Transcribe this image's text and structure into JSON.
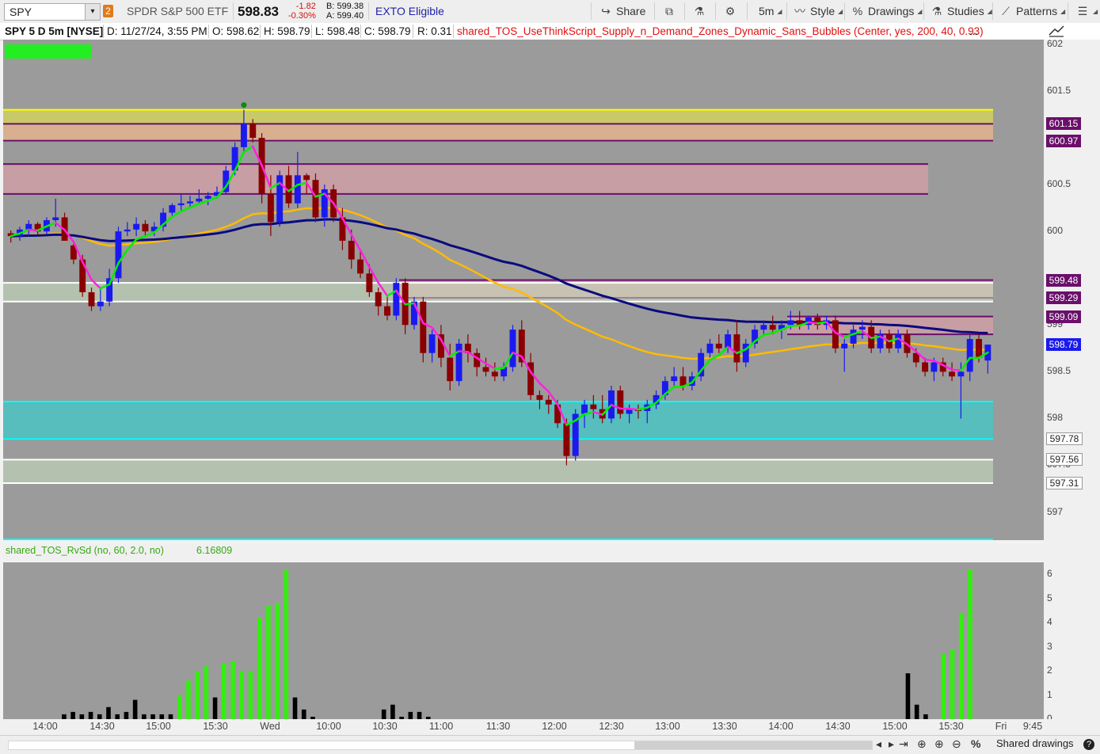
{
  "toolbar": {
    "symbol": "SPY",
    "link_number": "2",
    "description": "SPDR S&P 500 ETF",
    "last_price": "598.83",
    "net_change": "-1.82",
    "net_change_pct": "-0.30%",
    "bid": "B: 599.38",
    "ask": "A: 599.40",
    "exto": "EXTO Eligible",
    "share": "Share",
    "timeframe": "5m",
    "style": "Style",
    "drawings": "Drawings",
    "studies": "Studies",
    "patterns": "Patterns",
    "icons": {
      "share": "share-arrow-icon",
      "sync": "sync-icon",
      "flask": "flask-icon",
      "gear": "gear-icon",
      "style": "style-chart-icon",
      "drawings": "drawings-percent-icon",
      "studies": "studies-flask-icon",
      "patterns": "patterns-icon",
      "menu": "hamburger-menu-icon"
    }
  },
  "header": {
    "title": "SPY 5 D 5m [NYSE]",
    "date": "D: 11/27/24, 3:55 PM",
    "open": "O: 598.62",
    "high": "H: 598.79",
    "low": "L: 598.48",
    "close": "C: 598.79",
    "range": "R: 0.31",
    "study": "shared_TOS_UseThinkScript_Supply_n_Demand_Zones_Dynamic_Sans_Bubbles (Center, yes, 200, 40, 0.93)",
    "more": "..."
  },
  "lower_study": {
    "label": "shared_TOS_RvSd (no, 60, 2.0, no)",
    "value": "6.16809"
  },
  "price_axis": {
    "ticks": [
      "602",
      "601.5",
      "600.5",
      "600",
      "599",
      "598.5",
      "598",
      "597.5",
      "597"
    ],
    "tags": [
      {
        "label": "601.15",
        "color": "#6a0f6a"
      },
      {
        "label": "600.97",
        "color": "#6a0f6a"
      },
      {
        "label": "599.48",
        "color": "#6a0f6a"
      },
      {
        "label": "599.29",
        "color": "#6a0f6a"
      },
      {
        "label": "599.09",
        "color": "#6a0f6a"
      },
      {
        "label": "598.79",
        "color": "#1a1aee"
      },
      {
        "label": "597.78",
        "color": "#ffffff"
      },
      {
        "label": "597.56",
        "color": "#ffffff"
      },
      {
        "label": "597.31",
        "color": "#ffffff"
      }
    ]
  },
  "lower_axis": {
    "ticks": [
      "6",
      "5",
      "4",
      "3",
      "2",
      "1",
      "0"
    ]
  },
  "time_axis": {
    "labels": [
      "14:00",
      "14:30",
      "15:00",
      "15:30",
      "Wed",
      "10:00",
      "10:30",
      "11:00",
      "11:30",
      "12:00",
      "12:30",
      "13:00",
      "13:30",
      "14:00",
      "14:30",
      "15:00",
      "15:30",
      "Fri",
      "9:45"
    ]
  },
  "status_bar": {
    "shared_drawings": "Shared drawings",
    "help": "?"
  },
  "chart_data": {
    "type": "candlestick",
    "symbol": "SPY",
    "interval": "5m",
    "y_range": [
      596.7,
      602.05
    ],
    "grid": false,
    "colors": {
      "up": "#1a1aee",
      "down": "#8a0000",
      "background": "#9b9b9b",
      "ema_fast_up": "#00ee00",
      "ema_fast_down": "#ff22dd",
      "ema_slow": "#ffbb00",
      "ema_long": "#0a0a80"
    },
    "candles": [
      [
        599.98,
        600.01,
        599.88,
        599.95
      ],
      [
        599.95,
        600.05,
        599.9,
        600.02
      ],
      [
        600.02,
        600.12,
        599.95,
        600.08
      ],
      [
        600.08,
        600.1,
        599.96,
        600.0
      ],
      [
        600.0,
        600.15,
        599.97,
        600.12
      ],
      [
        600.12,
        600.35,
        600.05,
        600.15
      ],
      [
        600.15,
        600.2,
        599.95,
        599.9
      ],
      [
        599.85,
        599.9,
        599.65,
        599.7
      ],
      [
        599.7,
        599.75,
        599.3,
        599.35
      ],
      [
        599.35,
        599.4,
        599.15,
        599.2
      ],
      [
        599.2,
        599.4,
        599.15,
        599.25
      ],
      [
        599.25,
        599.6,
        599.2,
        599.5
      ],
      [
        599.5,
        600.05,
        599.45,
        600.0
      ],
      [
        600.0,
        600.1,
        599.95,
        600.02
      ],
      [
        600.02,
        600.15,
        599.95,
        600.08
      ],
      [
        600.08,
        600.12,
        599.95,
        600.0
      ],
      [
        600.0,
        600.1,
        599.95,
        600.05
      ],
      [
        600.05,
        600.25,
        600.0,
        600.2
      ],
      [
        600.2,
        600.3,
        600.15,
        600.28
      ],
      [
        600.28,
        600.4,
        600.22,
        600.3
      ],
      [
        600.3,
        600.38,
        600.25,
        600.32
      ],
      [
        600.32,
        600.45,
        600.3,
        600.35
      ],
      [
        600.35,
        600.42,
        600.28,
        600.38
      ],
      [
        600.38,
        600.48,
        600.35,
        600.42
      ],
      [
        600.42,
        600.7,
        600.4,
        600.65
      ],
      [
        600.65,
        600.95,
        600.6,
        600.9
      ],
      [
        600.9,
        601.3,
        600.85,
        601.15
      ],
      [
        601.15,
        601.2,
        600.95,
        601.0
      ],
      [
        601.0,
        601.05,
        600.3,
        600.4
      ],
      [
        600.4,
        600.6,
        599.95,
        600.1
      ],
      [
        600.1,
        600.65,
        600.05,
        600.6
      ],
      [
        600.6,
        600.7,
        600.25,
        600.3
      ],
      [
        600.3,
        600.85,
        600.25,
        600.6
      ],
      [
        600.6,
        600.62,
        600.4,
        600.55
      ],
      [
        600.55,
        600.62,
        600.1,
        600.15
      ],
      [
        600.15,
        600.5,
        600.05,
        600.45
      ],
      [
        600.45,
        600.5,
        600.1,
        600.15
      ],
      [
        600.15,
        600.25,
        599.8,
        599.9
      ],
      [
        599.9,
        600.02,
        599.6,
        599.7
      ],
      [
        599.7,
        599.8,
        599.5,
        599.55
      ],
      [
        599.55,
        599.65,
        599.3,
        599.35
      ],
      [
        599.35,
        599.4,
        599.1,
        599.2
      ],
      [
        599.2,
        599.3,
        599.05,
        599.1
      ],
      [
        599.1,
        599.5,
        599.05,
        599.45
      ],
      [
        599.45,
        599.5,
        598.9,
        599.0
      ],
      [
        599.0,
        599.3,
        598.95,
        599.25
      ],
      [
        599.25,
        599.3,
        598.6,
        598.7
      ],
      [
        598.7,
        598.95,
        598.6,
        598.9
      ],
      [
        598.9,
        599.0,
        598.55,
        598.65
      ],
      [
        598.65,
        598.8,
        598.3,
        598.4
      ],
      [
        598.4,
        598.85,
        598.35,
        598.8
      ],
      [
        598.8,
        598.9,
        598.6,
        598.7
      ],
      [
        598.7,
        598.75,
        598.45,
        598.55
      ],
      [
        598.55,
        598.65,
        598.45,
        598.5
      ],
      [
        598.5,
        598.6,
        598.4,
        598.45
      ],
      [
        598.45,
        598.6,
        598.4,
        598.55
      ],
      [
        598.55,
        599.0,
        598.5,
        598.95
      ],
      [
        598.95,
        599.05,
        598.55,
        598.6
      ],
      [
        598.6,
        598.7,
        598.2,
        598.25
      ],
      [
        598.25,
        598.3,
        598.1,
        598.2
      ],
      [
        598.2,
        598.25,
        598.05,
        598.15
      ],
      [
        598.15,
        598.2,
        597.9,
        597.95
      ],
      [
        597.95,
        598.0,
        597.5,
        597.6
      ],
      [
        597.6,
        598.1,
        597.55,
        598.05
      ],
      [
        598.05,
        598.2,
        597.9,
        598.15
      ],
      [
        598.15,
        598.25,
        598.0,
        598.1
      ],
      [
        598.1,
        598.25,
        597.95,
        598.0
      ],
      [
        598.0,
        598.35,
        597.95,
        598.3
      ],
      [
        598.3,
        598.35,
        598.0,
        598.05
      ],
      [
        598.05,
        598.15,
        597.95,
        598.1
      ],
      [
        598.1,
        598.15,
        598.0,
        598.08
      ],
      [
        598.08,
        598.2,
        597.95,
        598.15
      ],
      [
        598.15,
        598.3,
        598.1,
        598.25
      ],
      [
        598.25,
        598.45,
        598.2,
        598.4
      ],
      [
        598.4,
        598.55,
        598.35,
        598.45
      ],
      [
        598.45,
        598.55,
        598.3,
        598.35
      ],
      [
        598.35,
        598.5,
        598.3,
        598.45
      ],
      [
        598.45,
        598.75,
        598.4,
        598.7
      ],
      [
        598.7,
        598.85,
        598.65,
        598.8
      ],
      [
        598.8,
        598.9,
        598.7,
        598.75
      ],
      [
        598.75,
        598.95,
        598.7,
        598.9
      ],
      [
        598.9,
        599.05,
        598.5,
        598.6
      ],
      [
        598.6,
        598.85,
        598.55,
        598.8
      ],
      [
        598.8,
        599.0,
        598.75,
        598.95
      ],
      [
        598.95,
        599.05,
        598.9,
        599.0
      ],
      [
        599.0,
        599.1,
        598.9,
        598.95
      ],
      [
        598.95,
        599.05,
        598.85,
        599.0
      ],
      [
        599.0,
        599.15,
        598.95,
        599.05
      ],
      [
        599.05,
        599.15,
        598.95,
        599.0
      ],
      [
        599.0,
        599.1,
        598.95,
        599.08
      ],
      [
        599.08,
        599.12,
        598.95,
        599.0
      ],
      [
        599.0,
        599.1,
        598.95,
        599.05
      ],
      [
        599.05,
        599.1,
        598.7,
        598.75
      ],
      [
        598.75,
        598.85,
        598.5,
        598.8
      ],
      [
        598.8,
        599.0,
        598.75,
        598.95
      ],
      [
        598.95,
        599.05,
        598.85,
        598.98
      ],
      [
        598.98,
        599.05,
        598.7,
        598.75
      ],
      [
        598.75,
        598.95,
        598.7,
        598.9
      ],
      [
        598.9,
        598.95,
        598.7,
        598.75
      ],
      [
        598.75,
        598.95,
        598.7,
        598.9
      ],
      [
        598.9,
        598.95,
        598.65,
        598.7
      ],
      [
        598.7,
        598.75,
        598.55,
        598.6
      ],
      [
        598.6,
        598.65,
        598.45,
        598.5
      ],
      [
        598.5,
        598.65,
        598.4,
        598.6
      ],
      [
        598.6,
        598.65,
        598.45,
        598.5
      ],
      [
        598.5,
        598.6,
        598.4,
        598.45
      ],
      [
        598.45,
        598.6,
        598.0,
        598.5
      ],
      [
        598.5,
        598.9,
        598.4,
        598.85
      ],
      [
        598.85,
        598.9,
        598.6,
        598.65
      ],
      [
        598.62,
        598.79,
        598.48,
        598.79
      ]
    ],
    "zones": [
      {
        "from": 600.97,
        "to": 601.3,
        "kind": "supply-yellow"
      },
      {
        "from": 600.97,
        "to": 601.15,
        "kind": "supply"
      },
      {
        "from": 600.4,
        "to": 600.72,
        "kind": "supply"
      },
      {
        "from": 599.29,
        "to": 599.48,
        "kind": "supply"
      },
      {
        "from": 598.9,
        "to": 599.09,
        "kind": "supply"
      },
      {
        "from": 597.78,
        "to": 598.18,
        "kind": "demand-cyan"
      },
      {
        "from": 597.31,
        "to": 597.56,
        "kind": "demand"
      },
      {
        "from": 599.25,
        "to": 599.45,
        "kind": "demand"
      }
    ]
  },
  "volume_data": {
    "type": "bar",
    "ylim": [
      0,
      6.5
    ],
    "values": [
      0,
      0,
      0,
      0,
      0,
      0,
      0.2,
      0.3,
      0.2,
      0.3,
      0.2,
      0.5,
      0.2,
      0.3,
      0.8,
      0.2,
      0.2,
      0.2,
      0.2,
      1.0,
      1.6,
      2.0,
      2.2,
      0.9,
      2.3,
      2.4,
      2.0,
      2.0,
      4.2,
      4.7,
      4.8,
      6.2,
      0.9,
      0.4,
      0.1,
      0,
      0,
      0,
      0,
      0,
      0,
      0,
      0.4,
      0.6,
      0.1,
      0.3,
      0.3,
      0.1,
      0,
      0,
      0,
      0,
      0,
      0,
      0,
      0,
      0,
      0,
      0,
      0,
      0,
      0,
      0,
      0,
      0,
      0,
      0,
      0,
      0,
      0,
      0,
      0,
      0,
      0,
      0,
      0,
      0,
      0,
      0,
      0,
      0,
      0,
      0,
      0,
      0,
      0,
      0,
      0,
      0,
      0,
      0,
      0,
      0,
      0,
      0,
      0,
      0,
      0,
      0,
      0,
      0,
      1.9,
      0.6,
      0.2,
      0,
      2.7,
      2.9,
      4.4,
      6.2,
      0,
      0
    ],
    "green_indices": [
      19,
      20,
      21,
      22,
      24,
      25,
      26,
      27,
      28,
      29,
      30,
      31,
      105,
      106,
      107,
      108
    ]
  }
}
